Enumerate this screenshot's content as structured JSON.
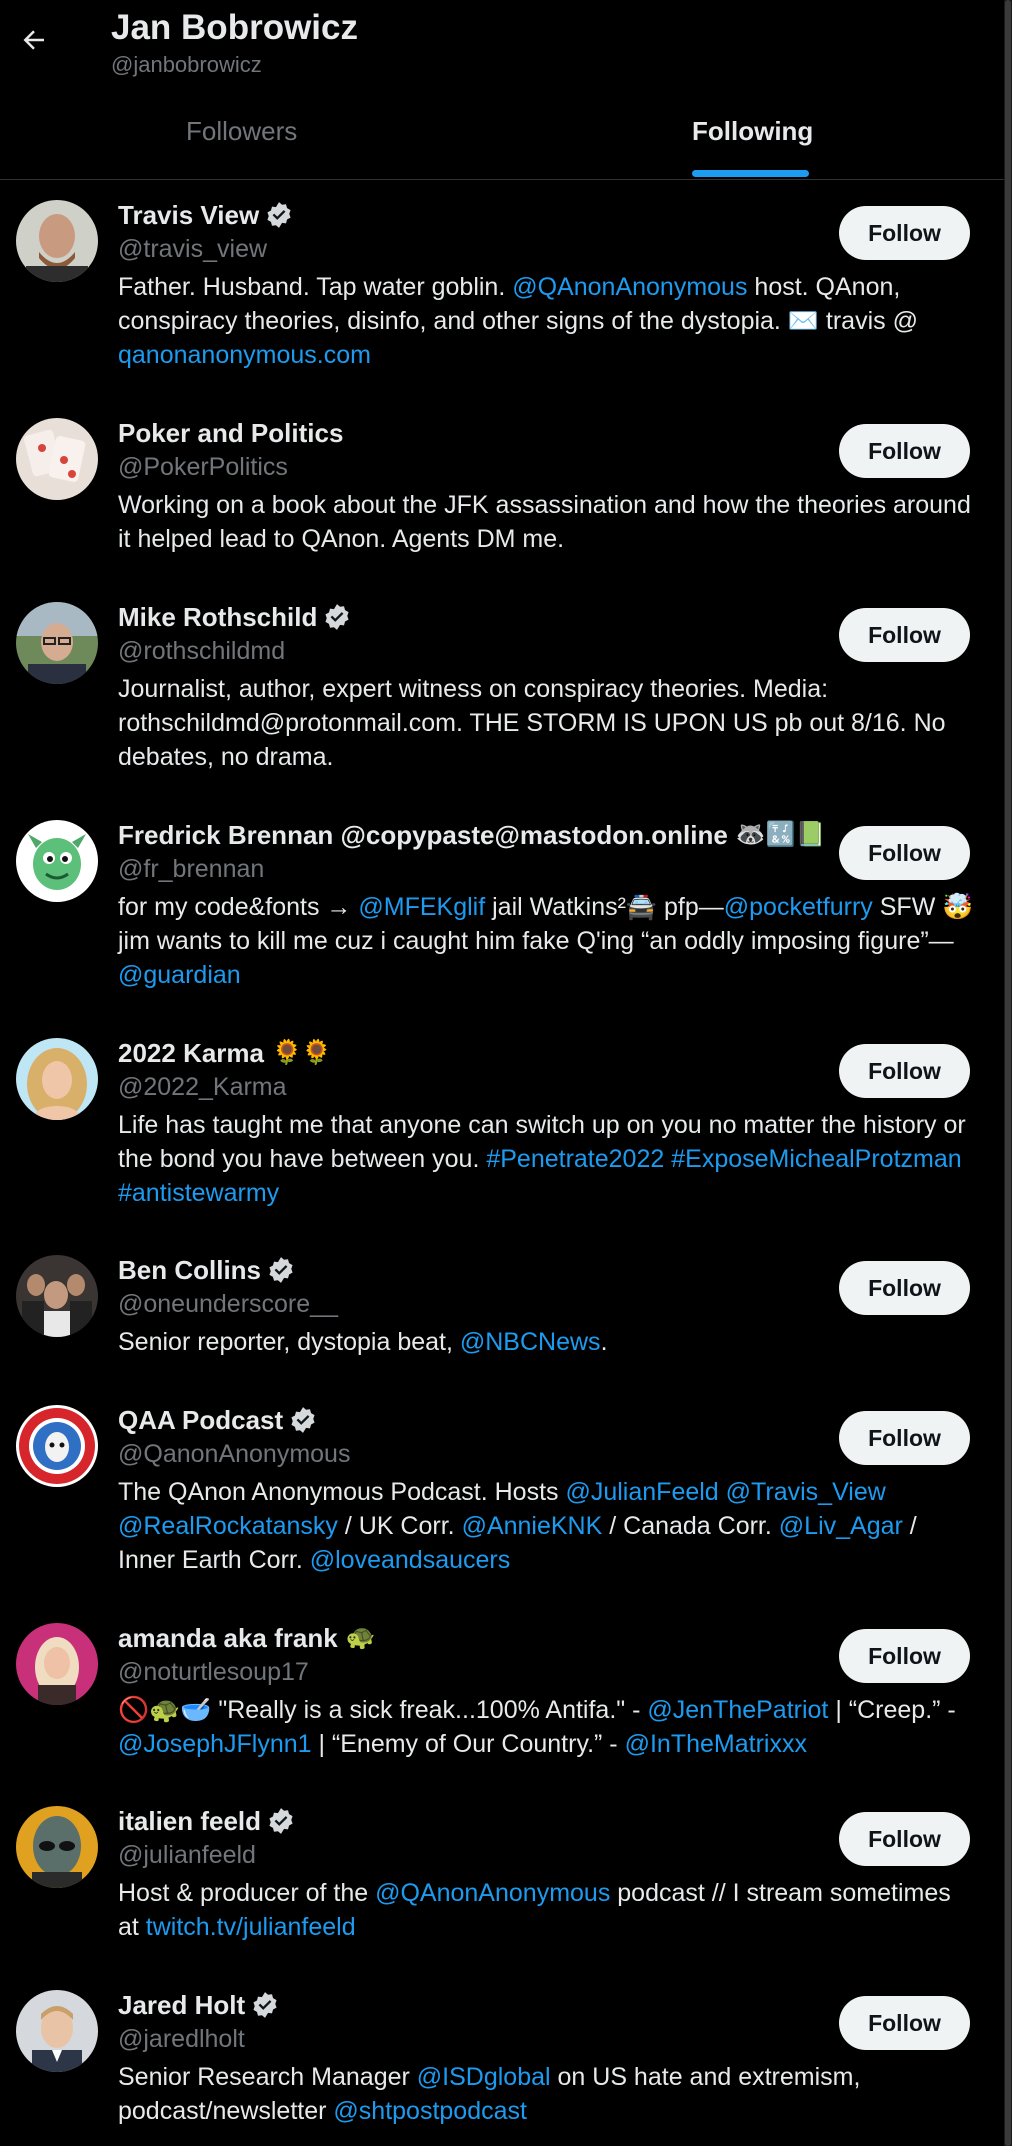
{
  "header": {
    "title": "Jan Bobrowicz",
    "handle": "@janbobrowicz",
    "tabs": {
      "followers": "Followers",
      "following": "Following"
    },
    "active_tab": "Following"
  },
  "colors": {
    "accent": "#1d9bf0",
    "background": "#000000",
    "text": "#e7e9ea",
    "muted": "#71767b",
    "button": "#eff3f4"
  },
  "follow_label": "Follow",
  "users": [
    {
      "name": "Travis View",
      "verified": true,
      "emoji": "",
      "handle": "@travis_view",
      "bio": [
        {
          "t": "Father. Husband. Tap water goblin. "
        },
        {
          "t": "@QAnonAnonymous",
          "link": true
        },
        {
          "t": " host. QAnon, conspiracy theories, disinfo, and other signs of the dystopia. ✉️ travis @ "
        },
        {
          "t": "qanonanonymous.com",
          "link": true
        }
      ]
    },
    {
      "name": "Poker and Politics",
      "verified": false,
      "emoji": "",
      "handle": "@PokerPolitics",
      "bio": [
        {
          "t": "Working on a book about the JFK assassination and how the theories around it helped lead to QAnon. Agents DM me."
        }
      ]
    },
    {
      "name": "Mike Rothschild",
      "verified": true,
      "emoji": "",
      "handle": "@rothschildmd",
      "bio": [
        {
          "t": "Journalist, author, expert witness on conspiracy theories. Media: rothschildmd@protonmail.com. THE STORM IS UPON US pb out 8/16. No debates, no drama."
        }
      ]
    },
    {
      "name": "Fredrick Brennan @copypaste@mastodon.online",
      "verified": false,
      "emoji": "🦝🔣📗",
      "handle": "@fr_brennan",
      "bio": [
        {
          "t": "for my code&fonts → "
        },
        {
          "t": "@MFEKglif",
          "link": true
        },
        {
          "t": " jail Watkins²🚔 pfp—"
        },
        {
          "t": "@pocketfurry",
          "link": true
        },
        {
          "t": " SFW 🤯 jim wants to kill me cuz i caught him fake Q'ing “an oddly imposing figure”—"
        },
        {
          "t": "@guardian",
          "link": true
        }
      ]
    },
    {
      "name": "2022 Karma",
      "verified": false,
      "emoji": "🌻🌻",
      "handle": "@2022_Karma",
      "bio": [
        {
          "t": "Life has taught me that anyone can switch up on you no matter the history or the bond you have between you. "
        },
        {
          "t": "#Penetrate2022",
          "link": true
        },
        {
          "t": " "
        },
        {
          "t": "#ExposeMichealProtzman",
          "link": true
        },
        {
          "t": " "
        },
        {
          "t": "#antistewarmy",
          "link": true
        }
      ]
    },
    {
      "name": "Ben Collins",
      "verified": true,
      "emoji": "",
      "handle": "@oneunderscore__",
      "bio": [
        {
          "t": "Senior reporter, dystopia beat, "
        },
        {
          "t": "@NBCNews",
          "link": true
        },
        {
          "t": "."
        }
      ]
    },
    {
      "name": "QAA Podcast",
      "verified": true,
      "emoji": "",
      "handle": "@QanonAnonymous",
      "bio": [
        {
          "t": "The QAnon Anonymous Podcast. Hosts "
        },
        {
          "t": "@JulianFeeld",
          "link": true
        },
        {
          "t": " "
        },
        {
          "t": "@Travis_View",
          "link": true
        },
        {
          "t": " "
        },
        {
          "t": "@RealRockatansky",
          "link": true
        },
        {
          "t": " / UK Corr. "
        },
        {
          "t": "@AnnieKNK",
          "link": true
        },
        {
          "t": " / Canada Corr. "
        },
        {
          "t": "@Liv_Agar",
          "link": true
        },
        {
          "t": " / Inner Earth Corr. "
        },
        {
          "t": "@loveandsaucers",
          "link": true
        }
      ]
    },
    {
      "name": "amanda aka frank",
      "verified": false,
      "emoji": "🐢",
      "handle": "@noturtlesoup17",
      "bio": [
        {
          "t": "🚫🐢🥣 \"Really is a sick freak...100% Antifa.\" - "
        },
        {
          "t": "@JenThePatriot",
          "link": true
        },
        {
          "t": " | “Creep.” - "
        },
        {
          "t": "@JosephJFlynn1",
          "link": true
        },
        {
          "t": " | “Enemy of Our Country.” - "
        },
        {
          "t": "@InTheMatrixxx",
          "link": true
        }
      ]
    },
    {
      "name": "italien feeld",
      "verified": true,
      "emoji": "",
      "handle": "@julianfeeld",
      "bio": [
        {
          "t": "Host & producer of the "
        },
        {
          "t": "@QAnonAnonymous",
          "link": true
        },
        {
          "t": " podcast // I stream sometimes at "
        },
        {
          "t": "twitch.tv/julianfeeld",
          "link": true
        }
      ]
    },
    {
      "name": "Jared Holt",
      "verified": true,
      "emoji": "",
      "handle": "@jaredlholt",
      "bio": [
        {
          "t": "Senior Research Manager "
        },
        {
          "t": "@ISDglobal",
          "link": true
        },
        {
          "t": " on US hate and extremism, podcast/newsletter "
        },
        {
          "t": "@shtpostpodcast",
          "link": true
        }
      ]
    }
  ]
}
